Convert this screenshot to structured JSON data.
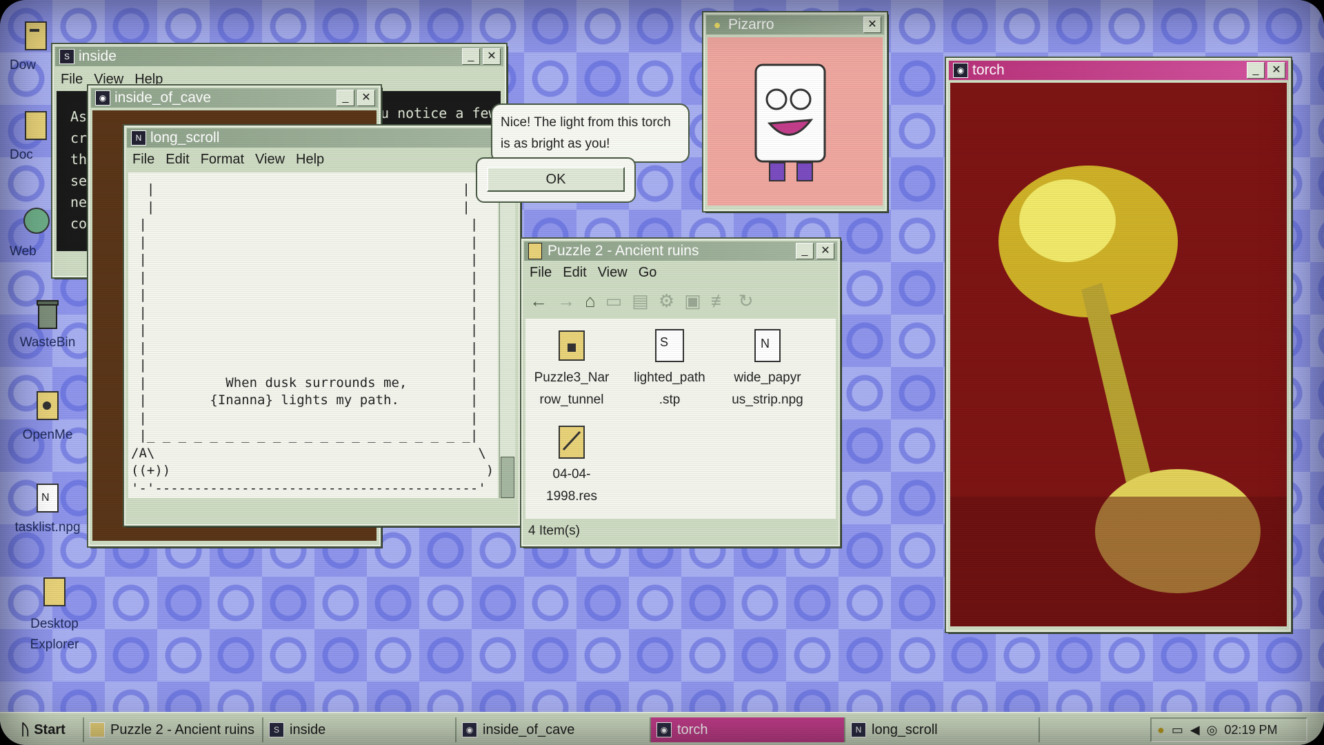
{
  "desktop": {
    "icons": [
      {
        "id": "downloads",
        "label": "Dow"
      },
      {
        "id": "documents",
        "label": "Doc"
      },
      {
        "id": "web",
        "label": "Web"
      },
      {
        "id": "wastebin",
        "label": "WasteBin"
      },
      {
        "id": "openme",
        "label": "OpenMe"
      },
      {
        "id": "tasklist",
        "label": "tasklist.npg"
      },
      {
        "id": "explorer",
        "label": "Desktop Explorer"
      }
    ]
  },
  "windows": {
    "inside": {
      "title": "inside",
      "menu": [
        "File",
        "View",
        "Help"
      ],
      "text_lines": [
        "As",
        "cra",
        "the",
        "see",
        "nex",
        "com"
      ],
      "partial_text": "u notice a few"
    },
    "inside_of_cave": {
      "title": "inside_of_cave"
    },
    "long_scroll": {
      "title": "long_scroll",
      "menu": [
        "File",
        "Edit",
        "Format",
        "View",
        "Help"
      ],
      "scroll_text": "  |                                       |\n  |                                       |\n |                                         |\n |                                         |\n |                                         |\n |                                         |\n |                                         |\n |                                         |\n |                                         |\n |                                         |\n |                                         |\n |          When dusk surrounds me,        |\n |        {Inanna} lights my path.         |\n |                                         |\n |_ _ _ _ _ _ _ _ _ _ _ _ _ _ _ _ _ _ _ _ _|\n/A\\                                         \\\n((+))                                        )\n'-'-----------------------------------------'"
    },
    "pizarro": {
      "title": "Pizarro"
    },
    "dialog": {
      "message": "Nice! The light from this torch is as bright as you!",
      "ok_label": "OK"
    },
    "puzzle2": {
      "title": "Puzzle 2 - Ancient ruins",
      "menu": [
        "File",
        "Edit",
        "View",
        "Go"
      ],
      "files": [
        {
          "name": "Puzzle3_Nar row_tunnel"
        },
        {
          "name": "lighted_path .stp"
        },
        {
          "name": "wide_papyr us_strip.npg"
        },
        {
          "name": "04-04- 1998.res"
        }
      ],
      "status": "4 Item(s)"
    },
    "torch": {
      "title": "torch"
    }
  },
  "taskbar": {
    "start_label": "Start",
    "tasks": [
      {
        "label": "Puzzle 2 - Ancient ruins",
        "active": false
      },
      {
        "label": "inside",
        "active": false
      },
      {
        "label": "inside_of_cave",
        "active": false
      },
      {
        "label": "torch",
        "active": true
      },
      {
        "label": "long_scroll",
        "active": false
      }
    ],
    "clock": "02:19 PM"
  },
  "colors": {
    "accent": "#c43e8c",
    "desktop": "#8f96ec",
    "window": "#cfdcc4"
  }
}
